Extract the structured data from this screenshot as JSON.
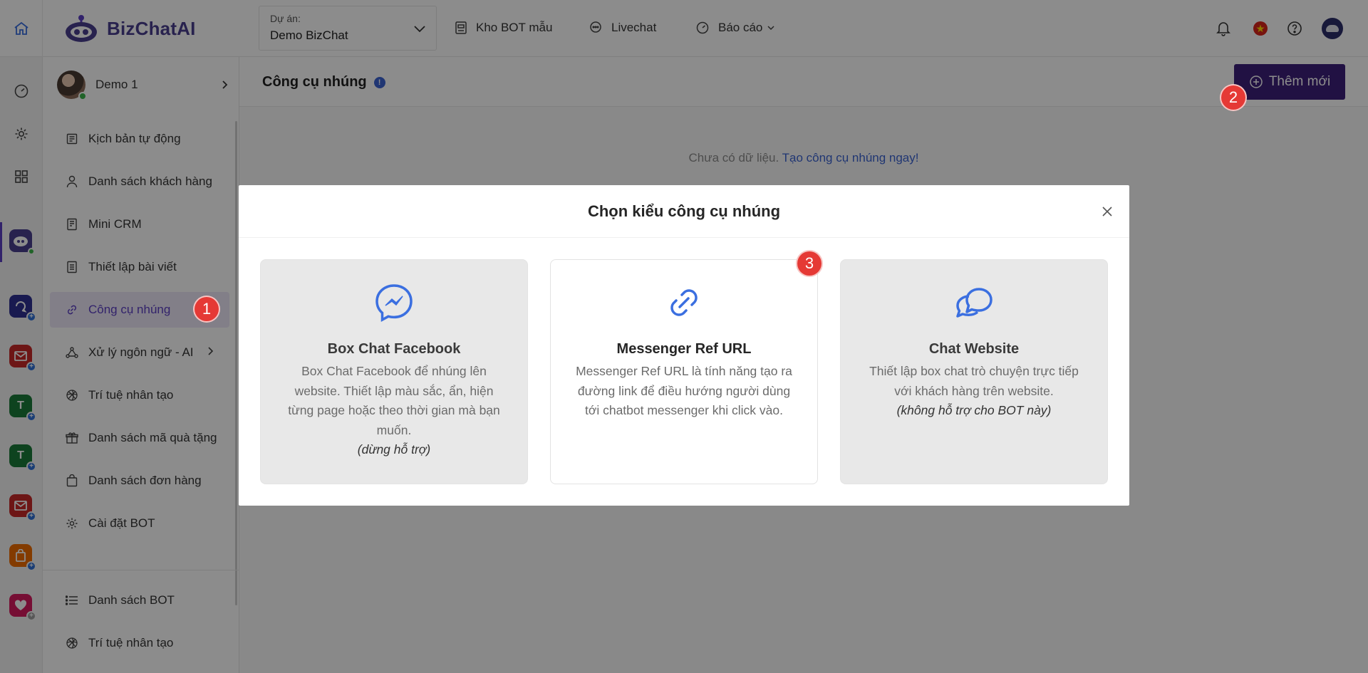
{
  "topbar": {
    "logo_text": "BizChatAI",
    "project_label": "Dự án:",
    "project_value": "Demo BizChat",
    "nav": [
      {
        "label": "Kho BOT mẫu",
        "icon": "robot-icon"
      },
      {
        "label": "Livechat",
        "icon": "chat-bubble-icon"
      },
      {
        "label": "Báo cáo",
        "icon": "dashboard-icon"
      }
    ],
    "right_icons": [
      "bell-icon",
      "vietnam-flag-icon",
      "help-icon",
      "user-avatar"
    ]
  },
  "rail": {
    "icons": [
      "home-icon",
      "dashboard-icon",
      "settings-icon",
      "apps-grid-icon",
      "bizchat-bot-icon"
    ],
    "apps": [
      "app-chat",
      "app-mail",
      "app-t-green",
      "app-t-green-2",
      "app-mail-2",
      "app-bag",
      "app-heart"
    ]
  },
  "sidebar": {
    "bot_name": "Demo 1",
    "items": [
      {
        "label": "Kịch bản tự động",
        "icon": "script-icon"
      },
      {
        "label": "Danh sách khách hàng",
        "icon": "user-icon"
      },
      {
        "label": "Mini CRM",
        "icon": "crm-icon"
      },
      {
        "label": "Thiết lập bài viết",
        "icon": "post-icon"
      },
      {
        "label": "Công cụ nhúng",
        "icon": "link-icon"
      },
      {
        "label": "Xử lý ngôn ngữ - AI",
        "icon": "nlp-icon"
      },
      {
        "label": "Trí tuệ nhân tạo",
        "icon": "ai-icon"
      },
      {
        "label": "Danh sách mã quà tặng",
        "icon": "gift-icon"
      },
      {
        "label": "Danh sách đơn hàng",
        "icon": "order-bag-icon"
      },
      {
        "label": "Cài đặt BOT",
        "icon": "gear-icon"
      }
    ],
    "bottom_items": [
      {
        "label": "Danh sách BOT",
        "icon": "list-icon"
      },
      {
        "label": "Trí tuệ nhân tạo",
        "icon": "ai-icon"
      }
    ]
  },
  "main": {
    "title": "Công cụ nhúng",
    "info_symbol": "!",
    "add_button": "Thêm mới",
    "empty_text": "Chưa có dữ liệu.",
    "empty_link": "Tạo công cụ nhúng ngay!"
  },
  "modal": {
    "title": "Chọn kiểu công cụ nhúng",
    "cards": [
      {
        "title": "Box Chat Facebook",
        "desc": "Box Chat Facebook để nhúng lên website. Thiết lập màu sắc, ẩn, hiện từng page hoặc theo thời gian mà bạn muốn.",
        "note": "(dừng hỗ trợ)",
        "icon": "messenger-icon",
        "enabled": false
      },
      {
        "title": "Messenger Ref URL",
        "desc": "Messenger Ref URL là tính năng tạo ra đường link để điều hướng người dùng tới chatbot messenger khi click vào.",
        "note": "",
        "icon": "link-chain-icon",
        "enabled": true
      },
      {
        "title": "Chat Website",
        "desc": "Thiết lập box chat trò chuyện trực tiếp với khách hàng trên website.",
        "note": "(không hỗ trợ cho BOT này)",
        "icon": "chat-bubbles-icon",
        "enabled": false
      }
    ]
  },
  "steps": [
    "1",
    "2",
    "3"
  ],
  "colors": {
    "brand": "#4a3e8f",
    "button": "#3d1f7a",
    "icon_blue": "#3b6fe0",
    "step_badge": "#e53935",
    "active_menu_bg": "#ede7f7"
  }
}
